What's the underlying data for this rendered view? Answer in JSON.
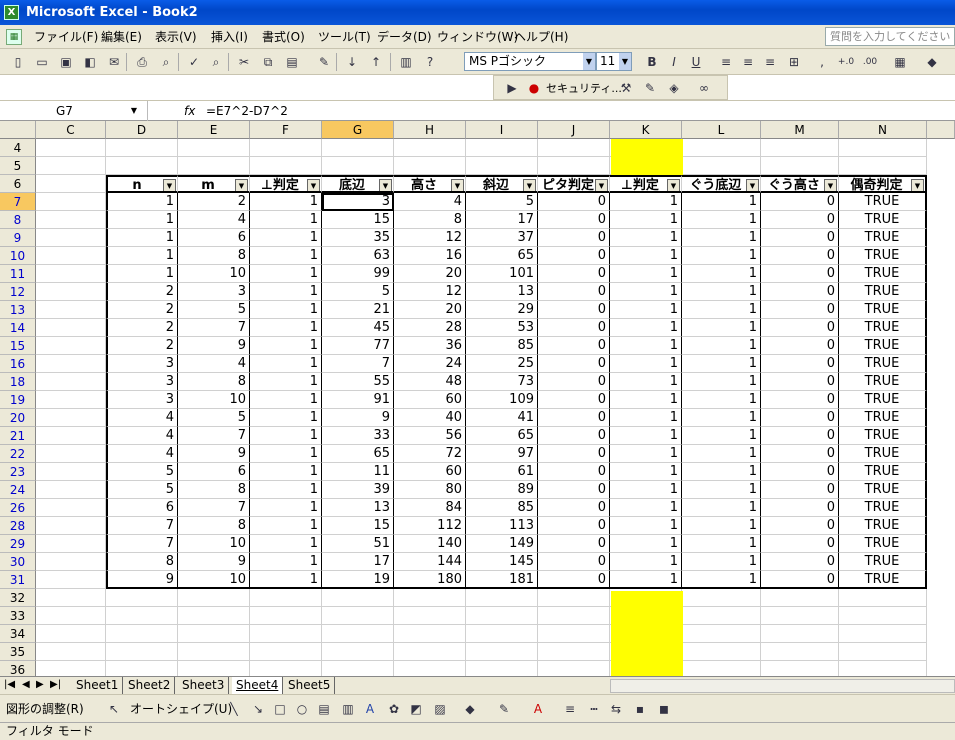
{
  "window": {
    "title": "Microsoft Excel - Book2"
  },
  "menu": {
    "items": [
      "ファイル(F)",
      "編集(E)",
      "表示(V)",
      "挿入(I)",
      "書式(O)",
      "ツール(T)",
      "データ(D)",
      "ウィンドウ(W)",
      "ヘルプ(H)"
    ],
    "help_placeholder": "質問を入力してください"
  },
  "toolbar": {
    "font": "MS Pゴシック",
    "size": "11",
    "security_label": "セキュリティ..."
  },
  "formula_bar": {
    "cell_ref": "G7",
    "fx": "fx",
    "formula": "=E7^2-D7^2"
  },
  "grid": {
    "columns": [
      "C",
      "D",
      "E",
      "F",
      "G",
      "H",
      "I",
      "J",
      "K",
      "L",
      "M",
      "N"
    ],
    "selected_column": "G",
    "row_numbers": [
      "4",
      "5",
      "6",
      "7",
      "8",
      "9",
      "10",
      "11",
      "12",
      "13",
      "14",
      "15",
      "16",
      "18",
      "19",
      "20",
      "21",
      "22",
      "23",
      "24",
      "26",
      "28",
      "29",
      "30",
      "31",
      "32",
      "33",
      "34",
      "35",
      "36"
    ],
    "headers": [
      "n",
      "m",
      "⊥判定",
      "底辺",
      "高さ",
      "斜辺",
      "ピタ判定",
      "⊥判定",
      "ぐう底辺",
      "ぐう高さ",
      "偶奇判定"
    ],
    "rows": [
      [
        "1",
        "2",
        "1",
        "3",
        "4",
        "5",
        "0",
        "1",
        "1",
        "0",
        "TRUE"
      ],
      [
        "1",
        "4",
        "1",
        "15",
        "8",
        "17",
        "0",
        "1",
        "1",
        "0",
        "TRUE"
      ],
      [
        "1",
        "6",
        "1",
        "35",
        "12",
        "37",
        "0",
        "1",
        "1",
        "0",
        "TRUE"
      ],
      [
        "1",
        "8",
        "1",
        "63",
        "16",
        "65",
        "0",
        "1",
        "1",
        "0",
        "TRUE"
      ],
      [
        "1",
        "10",
        "1",
        "99",
        "20",
        "101",
        "0",
        "1",
        "1",
        "0",
        "TRUE"
      ],
      [
        "2",
        "3",
        "1",
        "5",
        "12",
        "13",
        "0",
        "1",
        "1",
        "0",
        "TRUE"
      ],
      [
        "2",
        "5",
        "1",
        "21",
        "20",
        "29",
        "0",
        "1",
        "1",
        "0",
        "TRUE"
      ],
      [
        "2",
        "7",
        "1",
        "45",
        "28",
        "53",
        "0",
        "1",
        "1",
        "0",
        "TRUE"
      ],
      [
        "2",
        "9",
        "1",
        "77",
        "36",
        "85",
        "0",
        "1",
        "1",
        "0",
        "TRUE"
      ],
      [
        "3",
        "4",
        "1",
        "7",
        "24",
        "25",
        "0",
        "1",
        "1",
        "0",
        "TRUE"
      ],
      [
        "3",
        "8",
        "1",
        "55",
        "48",
        "73",
        "0",
        "1",
        "1",
        "0",
        "TRUE"
      ],
      [
        "3",
        "10",
        "1",
        "91",
        "60",
        "109",
        "0",
        "1",
        "1",
        "0",
        "TRUE"
      ],
      [
        "4",
        "5",
        "1",
        "9",
        "40",
        "41",
        "0",
        "1",
        "1",
        "0",
        "TRUE"
      ],
      [
        "4",
        "7",
        "1",
        "33",
        "56",
        "65",
        "0",
        "1",
        "1",
        "0",
        "TRUE"
      ],
      [
        "4",
        "9",
        "1",
        "65",
        "72",
        "97",
        "0",
        "1",
        "1",
        "0",
        "TRUE"
      ],
      [
        "5",
        "6",
        "1",
        "11",
        "60",
        "61",
        "0",
        "1",
        "1",
        "0",
        "TRUE"
      ],
      [
        "5",
        "8",
        "1",
        "39",
        "80",
        "89",
        "0",
        "1",
        "1",
        "0",
        "TRUE"
      ],
      [
        "6",
        "7",
        "1",
        "13",
        "84",
        "85",
        "0",
        "1",
        "1",
        "0",
        "TRUE"
      ],
      [
        "7",
        "8",
        "1",
        "15",
        "112",
        "113",
        "0",
        "1",
        "1",
        "0",
        "TRUE"
      ],
      [
        "7",
        "10",
        "1",
        "51",
        "140",
        "149",
        "0",
        "1",
        "1",
        "0",
        "TRUE"
      ],
      [
        "8",
        "9",
        "1",
        "17",
        "144",
        "145",
        "0",
        "1",
        "1",
        "0",
        "TRUE"
      ],
      [
        "9",
        "10",
        "1",
        "19",
        "180",
        "181",
        "0",
        "1",
        "1",
        "0",
        "TRUE"
      ]
    ]
  },
  "sheet_tabs": [
    "Sheet1",
    "Sheet2",
    "Sheet3",
    "Sheet4",
    "Sheet5"
  ],
  "active_sheet": "Sheet4",
  "drawing_toolbar": {
    "draw_label": "図形の調整(R)",
    "autoshape_label": "オートシェイプ(U)"
  },
  "status": {
    "text": "フィルタ モード"
  },
  "colors": {
    "highlight": "#ffff00",
    "selection_header": "#f8c860"
  }
}
